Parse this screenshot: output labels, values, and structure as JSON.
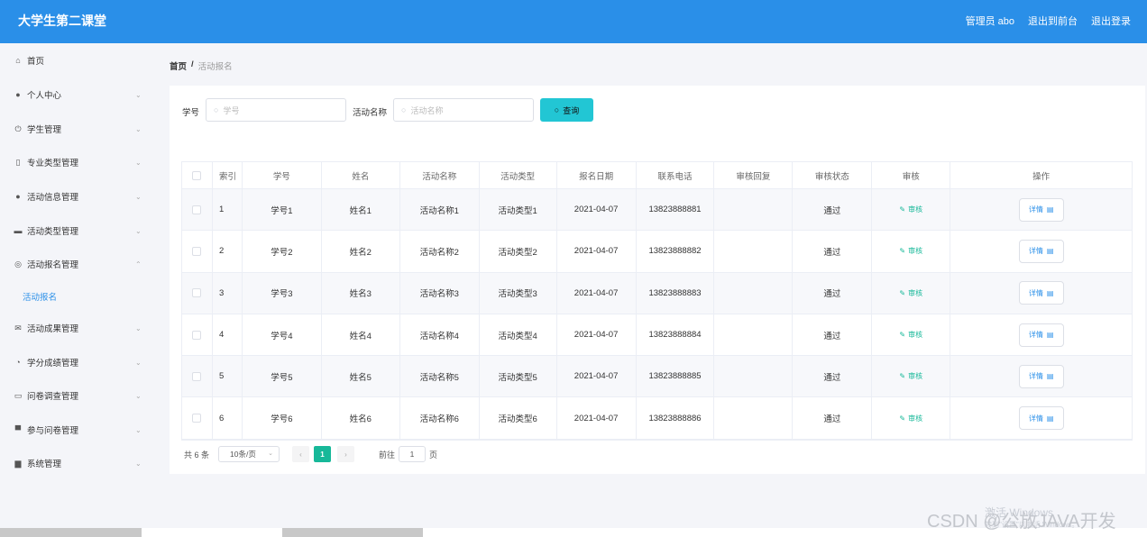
{
  "app": {
    "title": "大学生第二课堂"
  },
  "header": {
    "admin": "管理员 abo",
    "back_front": "退出到前台",
    "logout": "退出登录"
  },
  "sidebar": {
    "items": [
      {
        "label": "首页",
        "icon": "home-icon",
        "chev": ""
      },
      {
        "label": "个人中心",
        "icon": "user-icon",
        "chev": "⌄"
      },
      {
        "label": "学生管理",
        "icon": "power-icon",
        "chev": "⌄"
      },
      {
        "label": "专业类型管理",
        "icon": "lock-icon",
        "chev": "⌄"
      },
      {
        "label": "活动信息管理",
        "icon": "pin-icon",
        "chev": "⌄"
      },
      {
        "label": "活动类型管理",
        "icon": "chat-icon",
        "chev": "⌄"
      },
      {
        "label": "活动报名管理",
        "icon": "circle-icon",
        "chev": "⌃"
      }
    ],
    "sub_item": "活动报名",
    "items2": [
      {
        "label": "活动成果管理",
        "icon": "mail-icon",
        "chev": "⌄"
      },
      {
        "label": "学分成绩管理",
        "icon": "gauge-icon",
        "chev": "⌄"
      },
      {
        "label": "问卷调查管理",
        "icon": "message-icon",
        "chev": "⌄"
      },
      {
        "label": "参与问卷管理",
        "icon": "printer-icon",
        "chev": "⌄"
      },
      {
        "label": "系统管理",
        "icon": "briefcase-icon",
        "chev": "⌄"
      }
    ]
  },
  "breadcrumb": {
    "home": "首页",
    "sep": "/",
    "current": "活动报名"
  },
  "search": {
    "id_label": "学号",
    "id_placeholder": "学号",
    "name_label": "活动名称",
    "name_placeholder": "活动名称",
    "button": "查询"
  },
  "table": {
    "headers": [
      "索引",
      "学号",
      "姓名",
      "活动名称",
      "活动类型",
      "报名日期",
      "联系电话",
      "审核回复",
      "审核状态",
      "审核",
      "操作"
    ],
    "rows": [
      {
        "idx": "1",
        "sid": "学号1",
        "name": "姓名1",
        "activity": "活动名称1",
        "type": "活动类型1",
        "date": "2021-04-07",
        "phone": "13823888881",
        "reply": "",
        "status": "通过",
        "audit": "审核",
        "action": "详情"
      },
      {
        "idx": "2",
        "sid": "学号2",
        "name": "姓名2",
        "activity": "活动名称2",
        "type": "活动类型2",
        "date": "2021-04-07",
        "phone": "13823888882",
        "reply": "",
        "status": "通过",
        "audit": "审核",
        "action": "详情"
      },
      {
        "idx": "3",
        "sid": "学号3",
        "name": "姓名3",
        "activity": "活动名称3",
        "type": "活动类型3",
        "date": "2021-04-07",
        "phone": "13823888883",
        "reply": "",
        "status": "通过",
        "audit": "审核",
        "action": "详情"
      },
      {
        "idx": "4",
        "sid": "学号4",
        "name": "姓名4",
        "activity": "活动名称4",
        "type": "活动类型4",
        "date": "2021-04-07",
        "phone": "13823888884",
        "reply": "",
        "status": "通过",
        "audit": "审核",
        "action": "详情"
      },
      {
        "idx": "5",
        "sid": "学号5",
        "name": "姓名5",
        "activity": "活动名称5",
        "type": "活动类型5",
        "date": "2021-04-07",
        "phone": "13823888885",
        "reply": "",
        "status": "通过",
        "audit": "审核",
        "action": "详情"
      },
      {
        "idx": "6",
        "sid": "学号6",
        "name": "姓名6",
        "activity": "活动名称6",
        "type": "活动类型6",
        "date": "2021-04-07",
        "phone": "13823888886",
        "reply": "",
        "status": "通过",
        "audit": "审核",
        "action": "详情"
      }
    ]
  },
  "pagination": {
    "total": "共 6 条",
    "page_size": "10条/页",
    "current": "1",
    "goto_label": "前往",
    "goto_value": "1",
    "page_unit": "页"
  },
  "watermark": {
    "activate": "激活 Windows",
    "activate_hint": "转到\"设置\"以激活 Windows。",
    "csdn": "CSDN @公放JAVA开发"
  }
}
